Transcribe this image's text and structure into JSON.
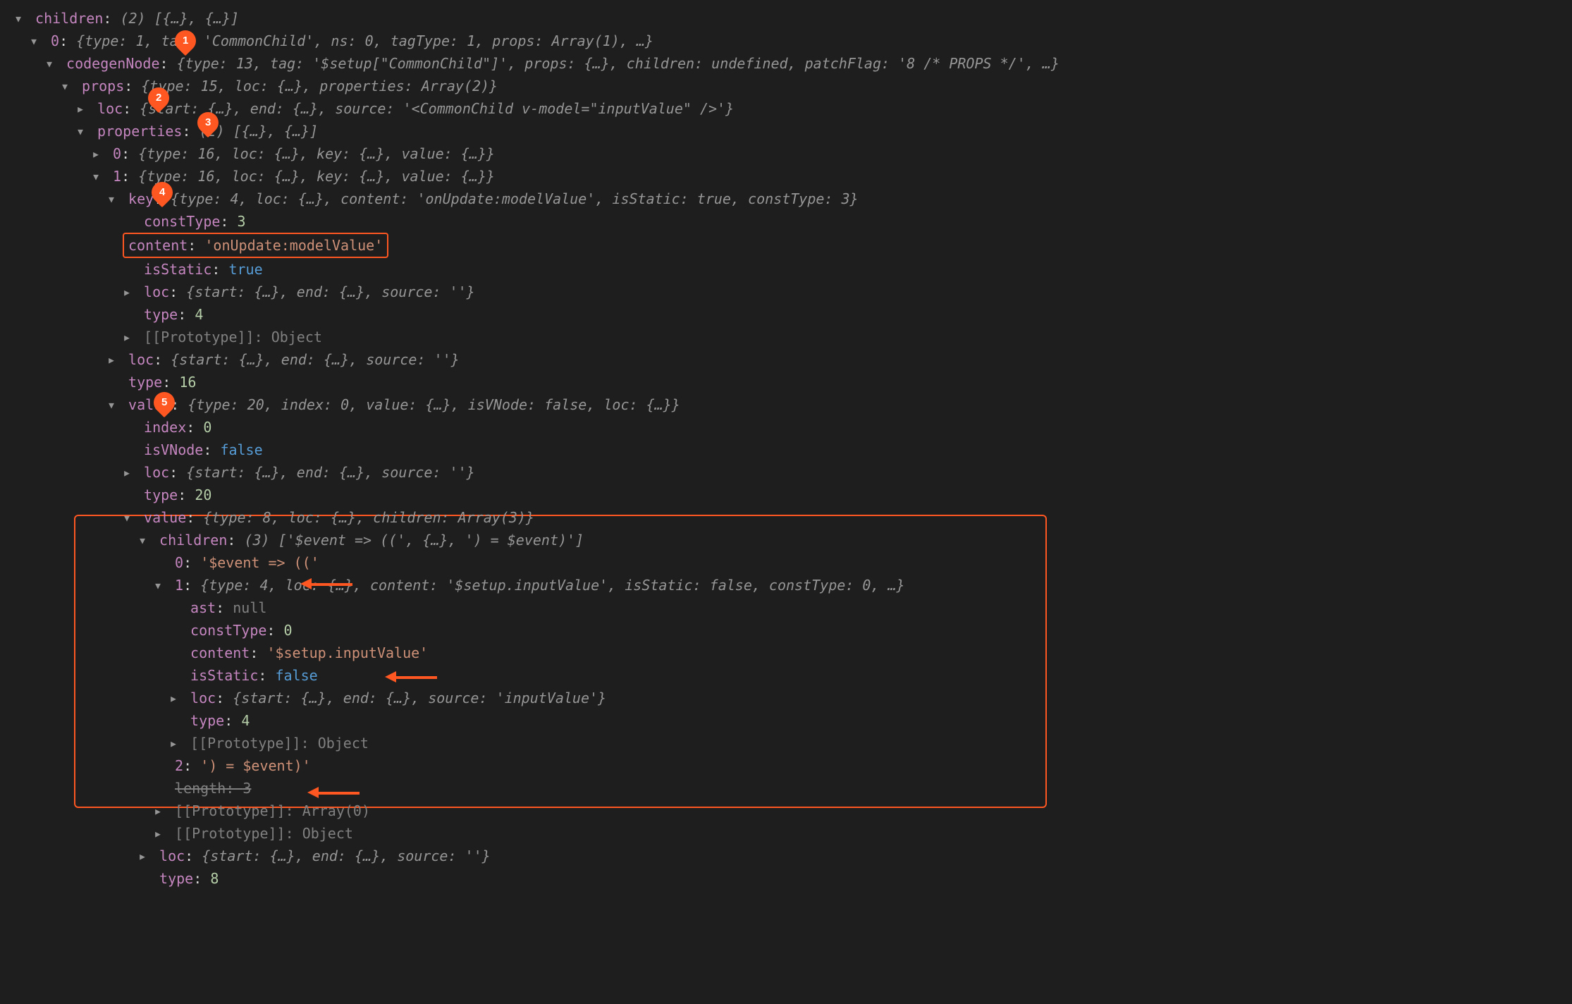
{
  "title_bar": "",
  "root": {
    "children_label": "children",
    "children_summary": "(2) [{…}, {…}]",
    "item0": {
      "label": "0",
      "summary": "{type: 1, tag: 'CommonChild', ns: 0, tagType: 1, props: Array(1), …}",
      "codegenNode": {
        "label": "codegenNode",
        "summary": "{type: 13, tag: '$setup[\"CommonChild\"]', props: {…}, children: undefined, patchFlag: '8 /* PROPS */', …}",
        "props": {
          "label": "props",
          "summary": "{type: 15, loc: {…}, properties: Array(2)}",
          "loc": {
            "label": "loc",
            "summary": "{start: {…}, end: {…}, source: '<CommonChild v-model=\"inputValue\" />'}"
          },
          "properties": {
            "label": "properties",
            "summary": "(2) [{…}, {…}]",
            "item0": {
              "label": "0",
              "summary": "{type: 16, loc: {…}, key: {…}, value: {…}}"
            },
            "item1": {
              "label": "1",
              "summary": "{type: 16, loc: {…}, key: {…}, value: {…}}",
              "key": {
                "label": "key",
                "summary": "{type: 4, loc: {…}, content: 'onUpdate:modelValue', isStatic: true, constType: 3}",
                "constType_label": "constType",
                "constType": "3",
                "content_label": "content",
                "content": "'onUpdate:modelValue'",
                "isStatic_label": "isStatic",
                "isStatic": "true",
                "loc_label": "loc",
                "loc_summary": "{start: {…}, end: {…}, source: ''}",
                "type_label": "type",
                "type": "4",
                "proto_label": "[[Prototype]]",
                "proto": "Object"
              },
              "loc_label": "loc",
              "loc_summary": "{start: {…}, end: {…}, source: ''}",
              "type_label": "type",
              "type": "16",
              "value": {
                "label": "value",
                "summary": "{type: 20, index: 0, value: {…}, isVNode: false, loc: {…}}",
                "index_label": "index",
                "index": "0",
                "isVNode_label": "isVNode",
                "isVNode": "false",
                "loc_label": "loc",
                "loc_summary": "{start: {…}, end: {…}, source: ''}",
                "type_label": "type",
                "type": "20",
                "innerValue": {
                  "label": "value",
                  "summary": "{type: 8, loc: {…}, children: Array(3)}",
                  "children": {
                    "label": "children",
                    "summary": "(3) ['$event => ((', {…}, ') = $event)']",
                    "c0_label": "0",
                    "c0": "'$event => (('",
                    "c1": {
                      "label": "1",
                      "summary": "{type: 4, loc: {…}, content: '$setup.inputValue', isStatic: false, constType: 0, …}",
                      "ast_label": "ast",
                      "ast": "null",
                      "constType_label": "constType",
                      "constType": "0",
                      "content_label": "content",
                      "content": "'$setup.inputValue'",
                      "isStatic_label": "isStatic",
                      "isStatic": "false",
                      "loc_label": "loc",
                      "loc_summary": "{start: {…}, end: {…}, source: 'inputValue'}",
                      "type_label": "type",
                      "type": "4",
                      "proto_label": "[[Prototype]]",
                      "proto": "Object"
                    },
                    "c2_label": "2",
                    "c2": "') = $event)'",
                    "length_label": "length",
                    "length": "3",
                    "proto1_label": "[[Prototype]]",
                    "proto1": "Array(0)",
                    "proto2_label": "[[Prototype]]",
                    "proto2": "Object"
                  },
                  "loc_label": "loc",
                  "loc_summary": "{start: {…}, end: {…}, source: ''}",
                  "type_label": "type",
                  "type": "8"
                }
              }
            }
          }
        }
      }
    }
  },
  "badges": {
    "b1": "1",
    "b2": "2",
    "b3": "3",
    "b4": "4",
    "b5": "5"
  }
}
